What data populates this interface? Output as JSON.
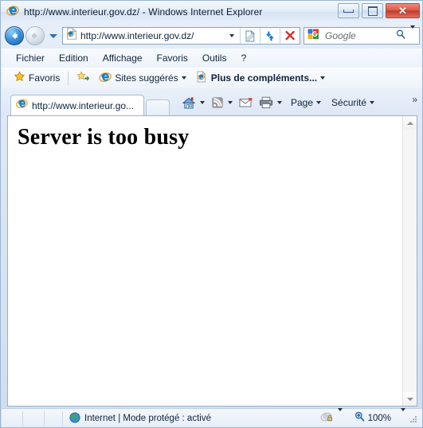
{
  "window": {
    "title": "http://www.interieur.gov.dz/ - Windows Internet Explorer",
    "app_icon": "ie-logo-icon",
    "controls": {
      "minimize_label": "Minimiser",
      "maximize_label": "Agrandir",
      "close_label": "Fermer"
    }
  },
  "navbar": {
    "back_label": "Précédente",
    "forward_label": "Suivante",
    "history_label": "Pages récentes",
    "address": {
      "favicon": "page-icon",
      "url": "http://www.interieur.gov.dz/",
      "dropdown_label": "Historique des adresses",
      "compatibility_label": "Affichage de compatibilité",
      "refresh_label": "Actualiser",
      "stop_label": "Arrêter"
    },
    "search": {
      "provider": "Google",
      "placeholder": "Google",
      "value": "",
      "search_icon": "magnifier-icon",
      "dropdown_label": "Choisir un moteur de recherche"
    }
  },
  "menubar": {
    "items": [
      {
        "label": "Fichier"
      },
      {
        "label": "Edition"
      },
      {
        "label": "Affichage"
      },
      {
        "label": "Favoris"
      },
      {
        "label": "Outils"
      },
      {
        "label": "?"
      }
    ]
  },
  "favbar": {
    "favorites_label": "Favoris",
    "items": [
      {
        "label": "Sites suggérés",
        "icon": "ie-logo-icon",
        "has_caret": true,
        "bold": false
      },
      {
        "label": "Plus de compléments...",
        "icon": "page-icon",
        "has_caret": true,
        "bold": true
      }
    ]
  },
  "tabbar": {
    "tabs": [
      {
        "label": "http://www.interieur.go...",
        "icon": "ie-logo-icon",
        "active": true
      }
    ],
    "new_tab_label": "Nouvel onglet",
    "commands": [
      {
        "name": "home-icon",
        "label": "",
        "caret": true
      },
      {
        "name": "rss-feed-icon",
        "label": "",
        "caret": true
      },
      {
        "name": "mail-icon",
        "label": "",
        "caret": false
      },
      {
        "name": "printer-icon",
        "label": "",
        "caret": true
      }
    ],
    "menus": [
      {
        "label": "Page"
      },
      {
        "label": "Sécurité"
      }
    ],
    "overflow_label": "»"
  },
  "page": {
    "heading": "Server is too busy"
  },
  "scrollbar": {
    "up_label": "Défiler vers le haut",
    "down_label": "Défiler vers le bas"
  },
  "statusbar": {
    "zone_icon": "globe-icon",
    "zone_text": "Internet | Mode protégé : activé",
    "protected_mode_icon": "lock-icon",
    "zoom_icon": "magnifier-plus-icon",
    "zoom_level": "100%",
    "resize_grip": "resize-grip-icon"
  },
  "colors": {
    "frame": "#cfdeef",
    "accent_blue": "#2c6fb5",
    "close_red": "#c3392c",
    "page_bg": "#ffffff"
  }
}
